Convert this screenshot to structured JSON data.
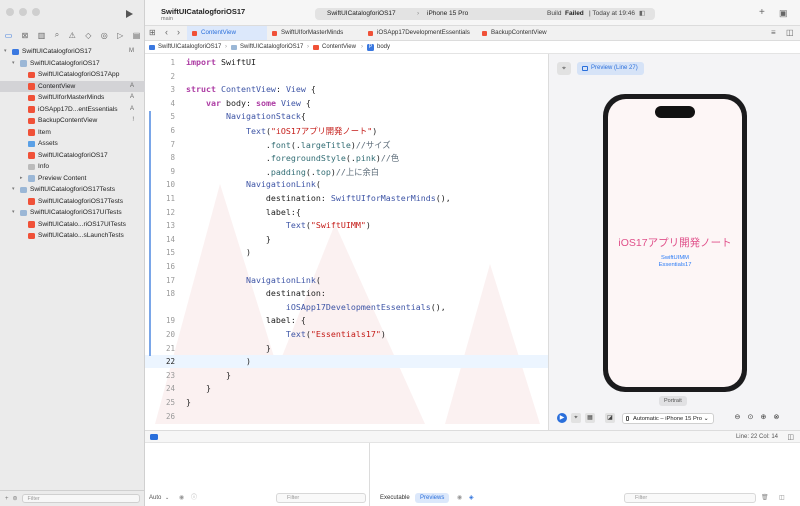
{
  "window": {
    "project_name": "SwiftUICatalogforiOS17",
    "branch": "main",
    "scheme_project": "SwiftUICatalogforiOS17",
    "scheme_device": "iPhone 15 Pro",
    "build_status_prefix": "Build",
    "build_status_word": "Failed",
    "build_status_time": "| Today at 19:46"
  },
  "sidebar": {
    "items": [
      {
        "label": "SwiftUICatalogforiOS17",
        "badge": "M",
        "level": 0,
        "icon": "project-icon",
        "expanded": true
      },
      {
        "label": "SwiftUICatalogforiOS17",
        "badge": "",
        "level": 1,
        "icon": "folder-icon",
        "expanded": true
      },
      {
        "label": "SwiftUICatalogforiOS17App",
        "badge": "",
        "level": 2,
        "icon": "swift-file-icon"
      },
      {
        "label": "ContentView",
        "badge": "A",
        "level": 2,
        "icon": "swift-file-icon",
        "selected": true
      },
      {
        "label": "SwiftUIforMasterMinds",
        "badge": "A",
        "level": 2,
        "icon": "swift-file-icon"
      },
      {
        "label": "iOSApp17D...entEssentials",
        "badge": "A",
        "level": 2,
        "icon": "swift-file-icon"
      },
      {
        "label": "BackupContentView",
        "badge": "!",
        "level": 2,
        "icon": "swift-file-icon"
      },
      {
        "label": "Item",
        "badge": "",
        "level": 2,
        "icon": "swift-file-icon"
      },
      {
        "label": "Assets",
        "badge": "",
        "level": 2,
        "icon": "assets-icon"
      },
      {
        "label": "SwiftUICatalogforiOS17",
        "badge": "",
        "level": 2,
        "icon": "swift-file-icon"
      },
      {
        "label": "Info",
        "badge": "",
        "level": 2,
        "icon": "info-icon"
      },
      {
        "label": "Preview Content",
        "badge": "",
        "level": 2,
        "icon": "folder-icon",
        "expanded": false
      },
      {
        "label": "SwiftUICatalogforiOS17Tests",
        "badge": "",
        "level": 1,
        "icon": "folder-icon",
        "expanded": true
      },
      {
        "label": "SwiftUICatalogforiOS17Tests",
        "badge": "",
        "level": 2,
        "icon": "swift-file-icon"
      },
      {
        "label": "SwiftUICatalogforiOS17UITests",
        "badge": "",
        "level": 1,
        "icon": "folder-icon",
        "expanded": true
      },
      {
        "label": "SwiftUICatalo...riOS17UITests",
        "badge": "",
        "level": 2,
        "icon": "swift-file-icon"
      },
      {
        "label": "SwiftUICatalo...sLaunchTests",
        "badge": "",
        "level": 2,
        "icon": "swift-file-icon"
      }
    ],
    "filter_placeholder": "Filter"
  },
  "tabs": [
    "ContentView",
    "SwiftUIforMasterMinds",
    "iOSApp17DevelopmentEssentials",
    "BackupContentView"
  ],
  "breadcrumb": [
    "SwiftUICatalogforiOS17",
    "SwiftUICatalogforiOS17",
    "ContentView",
    "body"
  ],
  "editor": {
    "current_line": 22,
    "lines": [
      {
        "n": "1",
        "html": "<span class='kw'>import</span> SwiftUI"
      },
      {
        "n": "2",
        "html": ""
      },
      {
        "n": "3",
        "html": "<span class='kw'>struct</span> <span class='ty'>ContentView</span>: <span class='ty'>View</span> {"
      },
      {
        "n": "4",
        "html": "    <span class='kw'>var</span> body: <span class='kw'>some</span> <span class='ty'>View</span> {"
      },
      {
        "n": "5",
        "html": "        <span class='ty'>NavigationStack</span>{"
      },
      {
        "n": "6",
        "html": "            <span class='ty'>Text</span>(<span class='str'>\"iOS17アプリ開発ノート\"</span>)"
      },
      {
        "n": "7",
        "html": "                .<span class='fn'>font</span>(.<span class='fn'>largeTitle</span>)<span class='cm'>//サイズ</span>"
      },
      {
        "n": "8",
        "html": "                .<span class='fn'>foregroundStyle</span>(.<span class='fn'>pink</span>)<span class='cm'>//色</span>"
      },
      {
        "n": "9",
        "html": "                .<span class='fn'>padding</span>(.<span class='fn'>top</span>)<span class='cm'>//上に余白</span>"
      },
      {
        "n": "10",
        "html": "            <span class='ty'>NavigationLink</span>("
      },
      {
        "n": "11",
        "html": "                destination: <span class='ty'>SwiftUIforMasterMinds</span>(),"
      },
      {
        "n": "12",
        "html": "                label:{"
      },
      {
        "n": "13",
        "html": "                    <span class='ty'>Text</span>(<span class='str'>\"SwiftUIMM\"</span>)"
      },
      {
        "n": "14",
        "html": "                }"
      },
      {
        "n": "15",
        "html": "            )"
      },
      {
        "n": "16",
        "html": ""
      },
      {
        "n": "17",
        "html": "            <span class='ty'>NavigationLink</span>("
      },
      {
        "n": "18",
        "html": "                destination:"
      },
      {
        "n": "",
        "html": "                    <span class='ty'>iOSApp17DevelopmentEssentials</span>(),"
      },
      {
        "n": "19",
        "html": "                label: {"
      },
      {
        "n": "20",
        "html": "                    <span class='ty'>Text</span>(<span class='str'>\"Essentials17\"</span>)"
      },
      {
        "n": "21",
        "html": "                }"
      },
      {
        "n": "22",
        "html": "            )"
      },
      {
        "n": "23",
        "html": "        }"
      },
      {
        "n": "24",
        "html": "    }"
      },
      {
        "n": "25",
        "html": "}"
      },
      {
        "n": "26",
        "html": ""
      }
    ]
  },
  "canvas": {
    "preview_label": "Preview (Line 27)",
    "preview_title": "iOS17アプリ開発ノート",
    "preview_link1": "SwiftUIMM",
    "preview_link2": "Essentials17",
    "title_color": "#e0508a",
    "link_color": "#2a7bf6",
    "orientation": "Portrait",
    "device_select": "Automatic – iPhone 15 Pro"
  },
  "status": {
    "cursor": "Line: 22  Col: 14"
  },
  "console": {
    "auto_label": "Auto",
    "left_filter": "Filter",
    "executable_label": "Executable",
    "previews_label": "Previews",
    "right_filter": "Filter"
  }
}
